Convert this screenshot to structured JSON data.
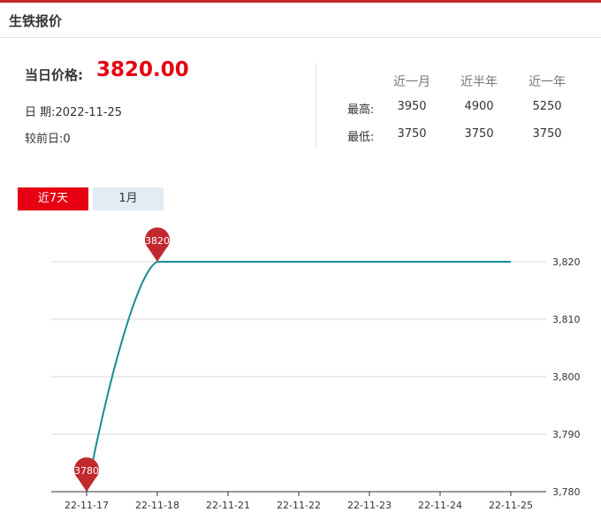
{
  "header": {
    "title": "生铁报价"
  },
  "price": {
    "label": "当日价格:",
    "value": "3820.00"
  },
  "info": {
    "date": "日 期:2022-11-25",
    "change": "较前日:0"
  },
  "stats": {
    "columns": [
      "近一月",
      "近半年",
      "近一年"
    ],
    "rows": [
      {
        "label": "最高:",
        "values": [
          "3950",
          "4900",
          "5250"
        ]
      },
      {
        "label": "最低:",
        "values": [
          "3750",
          "3750",
          "3750"
        ]
      }
    ]
  },
  "tabs": [
    {
      "label": "近7天",
      "active": true
    },
    {
      "label": "1月",
      "active": false
    }
  ],
  "colors": {
    "line": "#1a8a91",
    "marker": "#c1292e",
    "active_tab": "#e60012",
    "inactive_tab": "#e1ecf5"
  },
  "chart_data": {
    "type": "line",
    "categories": [
      "22-11-17",
      "22-11-18",
      "22-11-21",
      "22-11-22",
      "22-11-23",
      "22-11-24",
      "22-11-25"
    ],
    "values": [
      3780,
      3820,
      3820,
      3820,
      3820,
      3820,
      3820
    ],
    "ylim": [
      3780,
      3820
    ],
    "yticks": [
      "3,780",
      "3,790",
      "3,800",
      "3,810",
      "3,820"
    ],
    "markers": [
      {
        "index": 0,
        "label": "3780"
      },
      {
        "index": 1,
        "label": "3820"
      }
    ],
    "grid": true,
    "y_axis_side": "right"
  }
}
